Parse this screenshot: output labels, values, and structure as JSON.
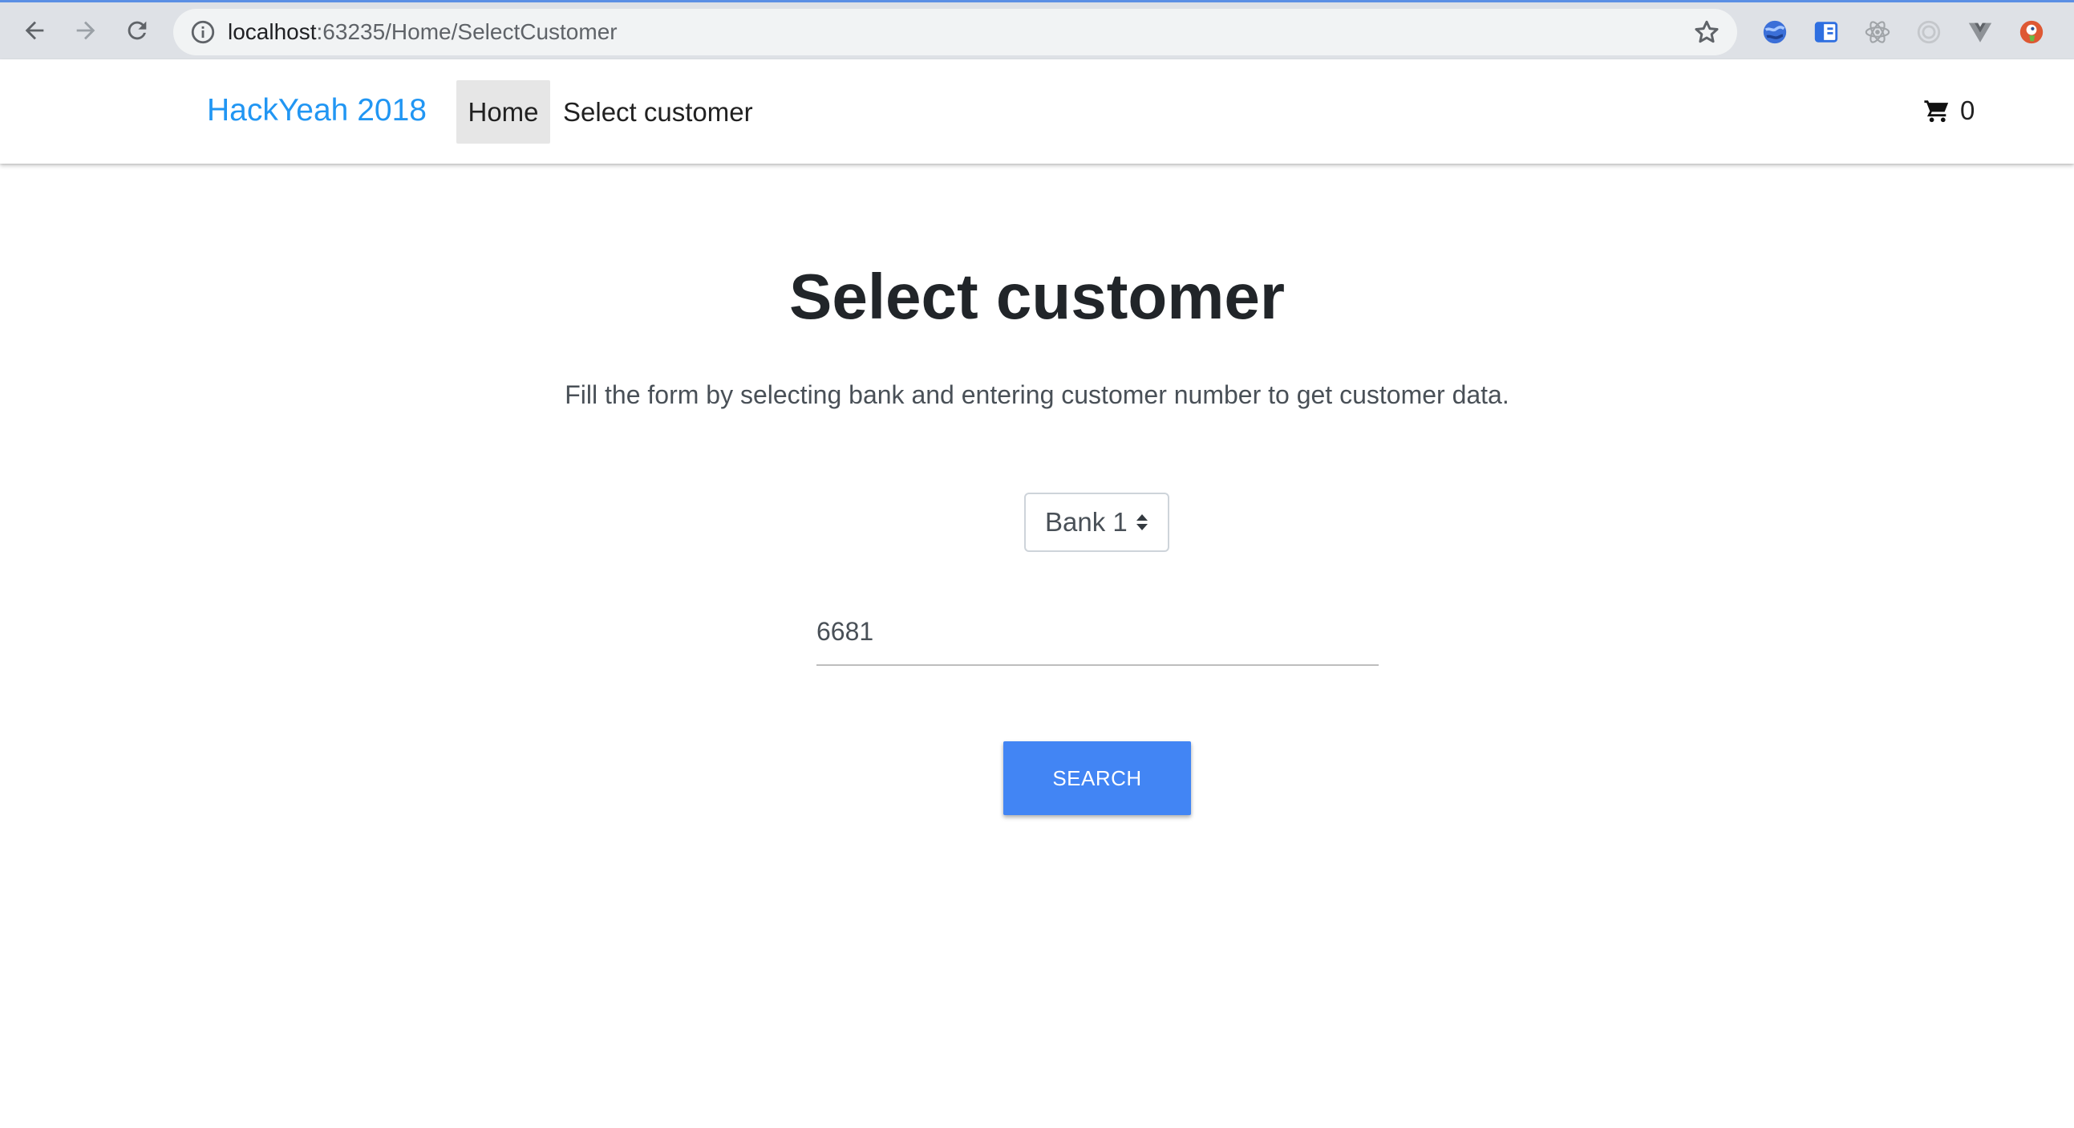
{
  "browser": {
    "url_host": "localhost",
    "url_rest": ":63235/Home/SelectCustomer",
    "colors": {
      "bar": "#dee1e6",
      "omnibox": "#f1f3f4"
    },
    "extensions": [
      "globe-extension-icon",
      "tab-extension-icon",
      "react-devtools-icon",
      "circle-extension-icon",
      "vue-devtools-icon",
      "duckduckgo-icon"
    ]
  },
  "navbar": {
    "brand": "HackYeah 2018",
    "home_label": "Home",
    "select_label": "Select customer",
    "cart_count": "0",
    "colors": {
      "brand": "#2196f3",
      "home_bg": "#e6e6e6"
    }
  },
  "main": {
    "title": "Select customer",
    "description": "Fill the form by selecting bank and entering customer number to get customer data.",
    "bank_selected": "Bank 1",
    "customer_number": "6681",
    "search_label": "SEARCH",
    "colors": {
      "search_button": "#4285f4"
    }
  }
}
